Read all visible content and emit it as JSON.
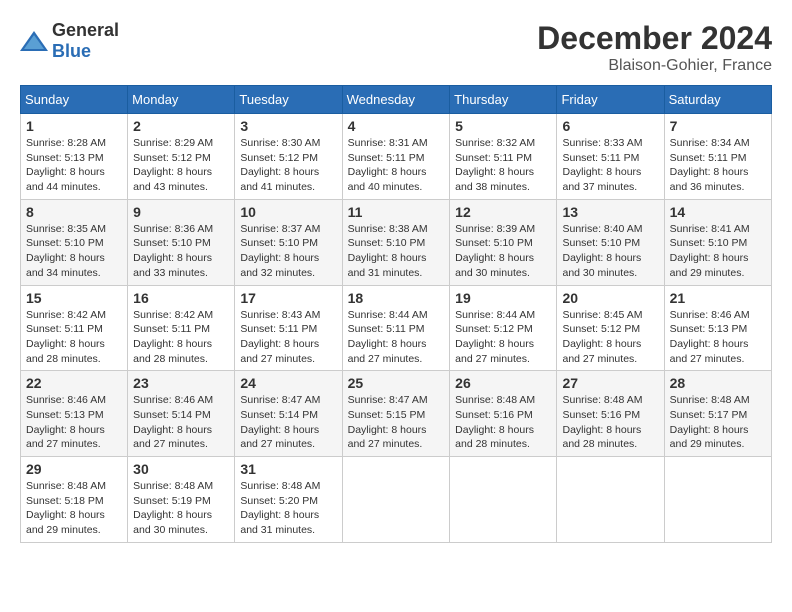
{
  "header": {
    "logo_general": "General",
    "logo_blue": "Blue",
    "title": "December 2024",
    "location": "Blaison-Gohier, France"
  },
  "calendar": {
    "days_of_week": [
      "Sunday",
      "Monday",
      "Tuesday",
      "Wednesday",
      "Thursday",
      "Friday",
      "Saturday"
    ],
    "weeks": [
      [
        null,
        {
          "day": "2",
          "sunrise": "Sunrise: 8:29 AM",
          "sunset": "Sunset: 5:12 PM",
          "daylight": "Daylight: 8 hours and 43 minutes."
        },
        {
          "day": "3",
          "sunrise": "Sunrise: 8:30 AM",
          "sunset": "Sunset: 5:12 PM",
          "daylight": "Daylight: 8 hours and 41 minutes."
        },
        {
          "day": "4",
          "sunrise": "Sunrise: 8:31 AM",
          "sunset": "Sunset: 5:11 PM",
          "daylight": "Daylight: 8 hours and 40 minutes."
        },
        {
          "day": "5",
          "sunrise": "Sunrise: 8:32 AM",
          "sunset": "Sunset: 5:11 PM",
          "daylight": "Daylight: 8 hours and 38 minutes."
        },
        {
          "day": "6",
          "sunrise": "Sunrise: 8:33 AM",
          "sunset": "Sunset: 5:11 PM",
          "daylight": "Daylight: 8 hours and 37 minutes."
        },
        {
          "day": "7",
          "sunrise": "Sunrise: 8:34 AM",
          "sunset": "Sunset: 5:11 PM",
          "daylight": "Daylight: 8 hours and 36 minutes."
        }
      ],
      [
        {
          "day": "1",
          "sunrise": "Sunrise: 8:28 AM",
          "sunset": "Sunset: 5:13 PM",
          "daylight": "Daylight: 8 hours and 44 minutes."
        },
        {
          "day": "9",
          "sunrise": "Sunrise: 8:36 AM",
          "sunset": "Sunset: 5:10 PM",
          "daylight": "Daylight: 8 hours and 33 minutes."
        },
        {
          "day": "10",
          "sunrise": "Sunrise: 8:37 AM",
          "sunset": "Sunset: 5:10 PM",
          "daylight": "Daylight: 8 hours and 32 minutes."
        },
        {
          "day": "11",
          "sunrise": "Sunrise: 8:38 AM",
          "sunset": "Sunset: 5:10 PM",
          "daylight": "Daylight: 8 hours and 31 minutes."
        },
        {
          "day": "12",
          "sunrise": "Sunrise: 8:39 AM",
          "sunset": "Sunset: 5:10 PM",
          "daylight": "Daylight: 8 hours and 30 minutes."
        },
        {
          "day": "13",
          "sunrise": "Sunrise: 8:40 AM",
          "sunset": "Sunset: 5:10 PM",
          "daylight": "Daylight: 8 hours and 30 minutes."
        },
        {
          "day": "14",
          "sunrise": "Sunrise: 8:41 AM",
          "sunset": "Sunset: 5:10 PM",
          "daylight": "Daylight: 8 hours and 29 minutes."
        }
      ],
      [
        {
          "day": "8",
          "sunrise": "Sunrise: 8:35 AM",
          "sunset": "Sunset: 5:10 PM",
          "daylight": "Daylight: 8 hours and 34 minutes."
        },
        {
          "day": "16",
          "sunrise": "Sunrise: 8:42 AM",
          "sunset": "Sunset: 5:11 PM",
          "daylight": "Daylight: 8 hours and 28 minutes."
        },
        {
          "day": "17",
          "sunrise": "Sunrise: 8:43 AM",
          "sunset": "Sunset: 5:11 PM",
          "daylight": "Daylight: 8 hours and 27 minutes."
        },
        {
          "day": "18",
          "sunrise": "Sunrise: 8:44 AM",
          "sunset": "Sunset: 5:11 PM",
          "daylight": "Daylight: 8 hours and 27 minutes."
        },
        {
          "day": "19",
          "sunrise": "Sunrise: 8:44 AM",
          "sunset": "Sunset: 5:12 PM",
          "daylight": "Daylight: 8 hours and 27 minutes."
        },
        {
          "day": "20",
          "sunrise": "Sunrise: 8:45 AM",
          "sunset": "Sunset: 5:12 PM",
          "daylight": "Daylight: 8 hours and 27 minutes."
        },
        {
          "day": "21",
          "sunrise": "Sunrise: 8:46 AM",
          "sunset": "Sunset: 5:13 PM",
          "daylight": "Daylight: 8 hours and 27 minutes."
        }
      ],
      [
        {
          "day": "15",
          "sunrise": "Sunrise: 8:42 AM",
          "sunset": "Sunset: 5:11 PM",
          "daylight": "Daylight: 8 hours and 28 minutes."
        },
        {
          "day": "23",
          "sunrise": "Sunrise: 8:46 AM",
          "sunset": "Sunset: 5:14 PM",
          "daylight": "Daylight: 8 hours and 27 minutes."
        },
        {
          "day": "24",
          "sunrise": "Sunrise: 8:47 AM",
          "sunset": "Sunset: 5:14 PM",
          "daylight": "Daylight: 8 hours and 27 minutes."
        },
        {
          "day": "25",
          "sunrise": "Sunrise: 8:47 AM",
          "sunset": "Sunset: 5:15 PM",
          "daylight": "Daylight: 8 hours and 27 minutes."
        },
        {
          "day": "26",
          "sunrise": "Sunrise: 8:48 AM",
          "sunset": "Sunset: 5:16 PM",
          "daylight": "Daylight: 8 hours and 28 minutes."
        },
        {
          "day": "27",
          "sunrise": "Sunrise: 8:48 AM",
          "sunset": "Sunset: 5:16 PM",
          "daylight": "Daylight: 8 hours and 28 minutes."
        },
        {
          "day": "28",
          "sunrise": "Sunrise: 8:48 AM",
          "sunset": "Sunset: 5:17 PM",
          "daylight": "Daylight: 8 hours and 29 minutes."
        }
      ],
      [
        {
          "day": "22",
          "sunrise": "Sunrise: 8:46 AM",
          "sunset": "Sunset: 5:13 PM",
          "daylight": "Daylight: 8 hours and 27 minutes."
        },
        {
          "day": "30",
          "sunrise": "Sunrise: 8:48 AM",
          "sunset": "Sunset: 5:19 PM",
          "daylight": "Daylight: 8 hours and 30 minutes."
        },
        {
          "day": "31",
          "sunrise": "Sunrise: 8:48 AM",
          "sunset": "Sunset: 5:20 PM",
          "daylight": "Daylight: 8 hours and 31 minutes."
        },
        null,
        null,
        null,
        null
      ],
      [
        {
          "day": "29",
          "sunrise": "Sunrise: 8:48 AM",
          "sunset": "Sunset: 5:18 PM",
          "daylight": "Daylight: 8 hours and 29 minutes."
        },
        null,
        null,
        null,
        null,
        null,
        null
      ]
    ]
  }
}
